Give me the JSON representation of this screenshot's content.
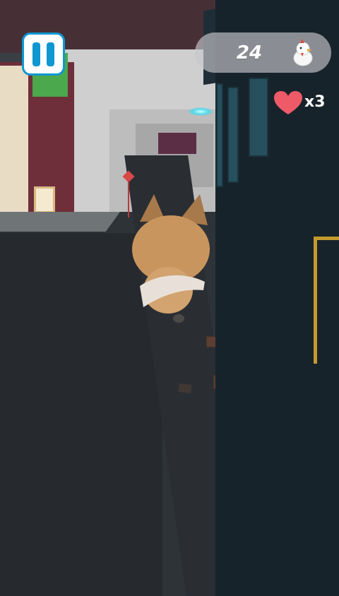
{
  "hud": {
    "score": "24",
    "lives": "x3",
    "score_icon": "chicken-icon",
    "lives_icon": "heart-icon",
    "pause_icon": "pause-icon"
  },
  "colors": {
    "pause_blue": "#0f97d1",
    "heart_red": "#ef5a68",
    "score_pill": "#c8c8ce"
  }
}
